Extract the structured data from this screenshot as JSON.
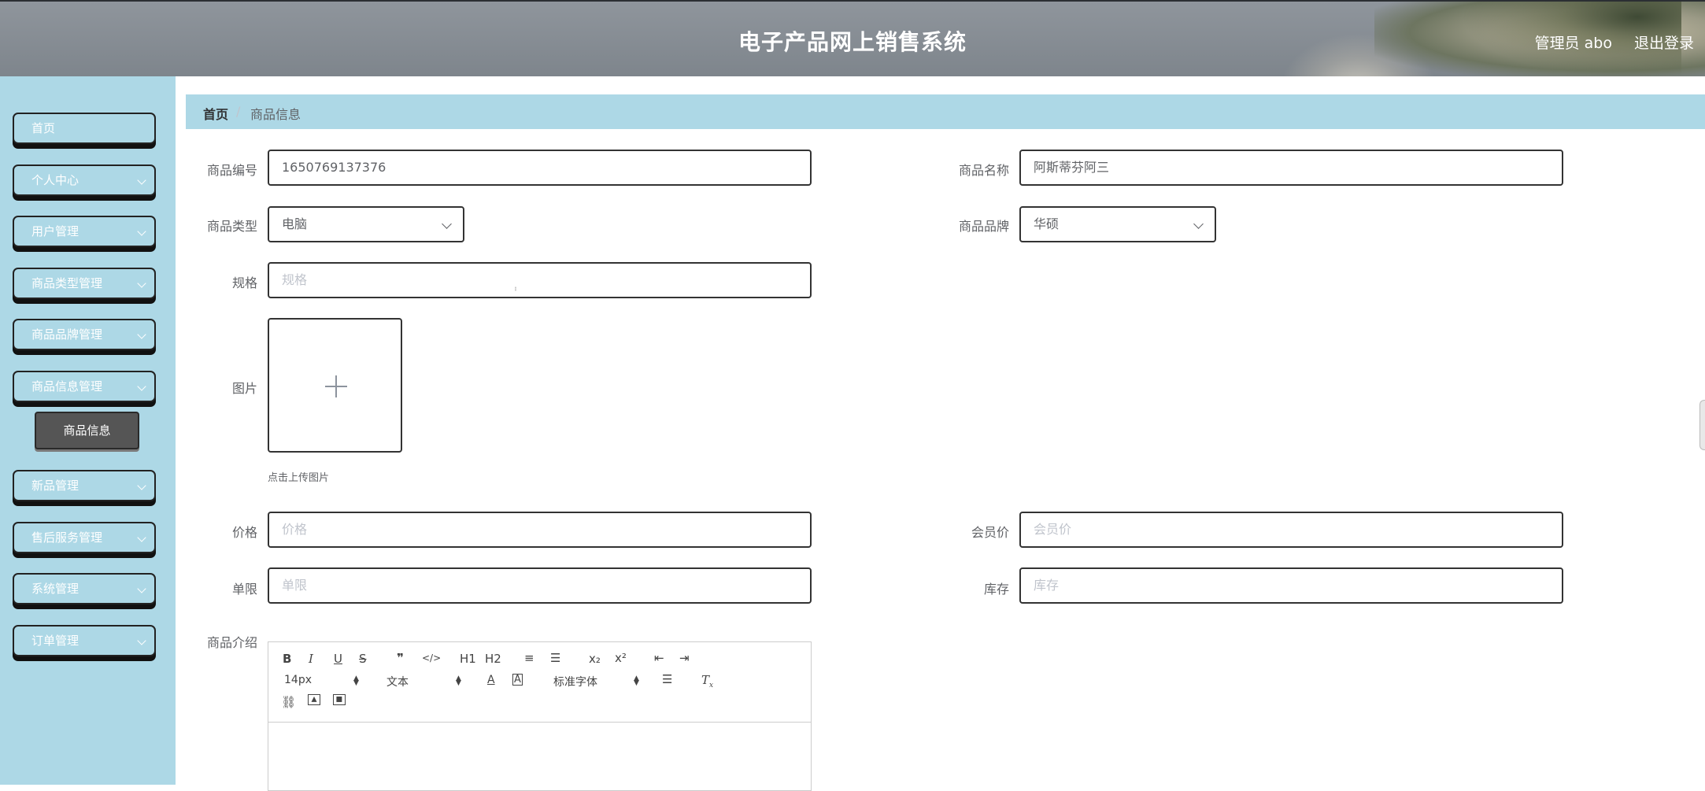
{
  "header": {
    "title": "电子产品网上销售系统",
    "admin_label": "管理员 abo",
    "logout_label": "退出登录"
  },
  "sidebar": {
    "items": [
      {
        "label": "首页",
        "has_arrow": false
      },
      {
        "label": "个人中心",
        "has_arrow": true
      },
      {
        "label": "用户管理",
        "has_arrow": true
      },
      {
        "label": "商品类型管理",
        "has_arrow": true
      },
      {
        "label": "商品品牌管理",
        "has_arrow": true
      },
      {
        "label": "商品信息管理",
        "has_arrow": true
      },
      {
        "label": "新品管理",
        "has_arrow": true
      },
      {
        "label": "售后服务管理",
        "has_arrow": true
      },
      {
        "label": "系统管理",
        "has_arrow": true
      },
      {
        "label": "订单管理",
        "has_arrow": true
      }
    ],
    "active_sub_item": "商品信息"
  },
  "breadcrumb": {
    "home": "首页",
    "separator": "/",
    "current": "商品信息"
  },
  "form": {
    "product_no": {
      "label": "商品编号",
      "value": "1650769137376"
    },
    "product_name": {
      "label": "商品名称",
      "value": "阿斯蒂芬阿三"
    },
    "product_type": {
      "label": "商品类型",
      "value": "电脑"
    },
    "product_brand": {
      "label": "商品品牌",
      "value": "华硕"
    },
    "spec": {
      "label": "规格",
      "placeholder": "规格"
    },
    "image": {
      "label": "图片",
      "tip": "点击上传图片"
    },
    "price": {
      "label": "价格",
      "placeholder": "价格"
    },
    "member_price": {
      "label": "会员价",
      "placeholder": "会员价"
    },
    "limit": {
      "label": "单限",
      "placeholder": "单限"
    },
    "stock": {
      "label": "库存",
      "placeholder": "库存"
    },
    "intro": {
      "label": "商品介绍"
    }
  },
  "editor": {
    "toolbar_row1": [
      "B",
      "I",
      "U",
      "S",
      "❞",
      "</>",
      "H1",
      "H2",
      "≡",
      "☰",
      "x₂",
      "x²",
      "⇤",
      "⇥"
    ],
    "font_size": "14px",
    "text_type": "文本",
    "font_family": "标准字体",
    "colors": {
      "accent": "#add8e6",
      "header": "#7e858c",
      "active_sub": "#555555"
    }
  }
}
